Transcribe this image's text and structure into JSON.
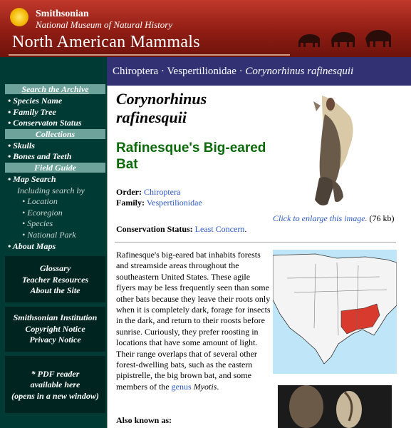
{
  "header": {
    "institution": "Smithsonian",
    "museum": "National Museum of Natural History",
    "site_title": "North American Mammals"
  },
  "breadcrumb": {
    "order": "Chiroptera",
    "sep1": " · ",
    "family": "Vespertilionidae",
    "sep2": " · ",
    "species": "Corynorhinus rafinesquii"
  },
  "sidebar": {
    "search_archive": "Search the Archive",
    "search_items": [
      "• Species Name",
      "• Family Tree",
      "• Conservaton Status"
    ],
    "collections": "Collections",
    "collection_items": [
      "• Skulls",
      "• Bones and Teeth"
    ],
    "field_guide": "Field Guide",
    "map_search": "• Map Search",
    "including": "Including search by",
    "map_sub": [
      "• Location",
      "• Ecoregion",
      "• Species",
      "• National Park"
    ],
    "about_maps": "• About Maps",
    "box1": [
      "Glossary",
      "Teacher Resources",
      "About the Site"
    ],
    "box2": [
      "Smithsonian Institution",
      "Copyright Notice",
      "Privacy Notice"
    ],
    "box3": [
      "* PDF reader",
      "available here",
      "(opens in a new window)"
    ]
  },
  "species": {
    "scientific_line1": "Corynorhinus",
    "scientific_line2": "rafinesquii",
    "common_line1": "Rafinesque's Big-eared",
    "common_line2": "Bat",
    "order_label": "Order:",
    "order_value": "Chiroptera",
    "family_label": "Family:",
    "family_value": "Vespertilionidae",
    "status_label": "Conservation Status:",
    "status_value": "Least Concern",
    "status_end": ".",
    "caption_link": "Click to enlarge this image.",
    "caption_size": " (76 kb)",
    "paragraph_main": "Rafinesque's big-eared bat inhabits forests and streamside areas throughout the southeastern United States. These agile flyers may be less frequently seen than some other bats because they leave their roots only when it is completely dark, forage for insects in the dark, and return to their roosts before sunrise. Curiously, they prefer roosting in locations that have some amount of light. Their range overlaps that of several other forest-dwelling bats, such as the eastern pipistrelle, the big brown bat, and some members of the ",
    "genus_link": "genus",
    "genus_name": "Myotis",
    "paragraph_end": ".",
    "also_known": "Also known as:"
  },
  "colors": {
    "header_red": "#a0261b",
    "sidebar_green": "#003a34",
    "section_teal": "#6da39a",
    "breadcrumb_navy": "#313174",
    "link_blue": "#2b57c7",
    "title_green": "#0a6a0a",
    "range_red": "#d93a2e"
  },
  "icons": [
    "smithsonian-sun-logo",
    "bison-silhouette",
    "bat-specimen",
    "range-map"
  ]
}
